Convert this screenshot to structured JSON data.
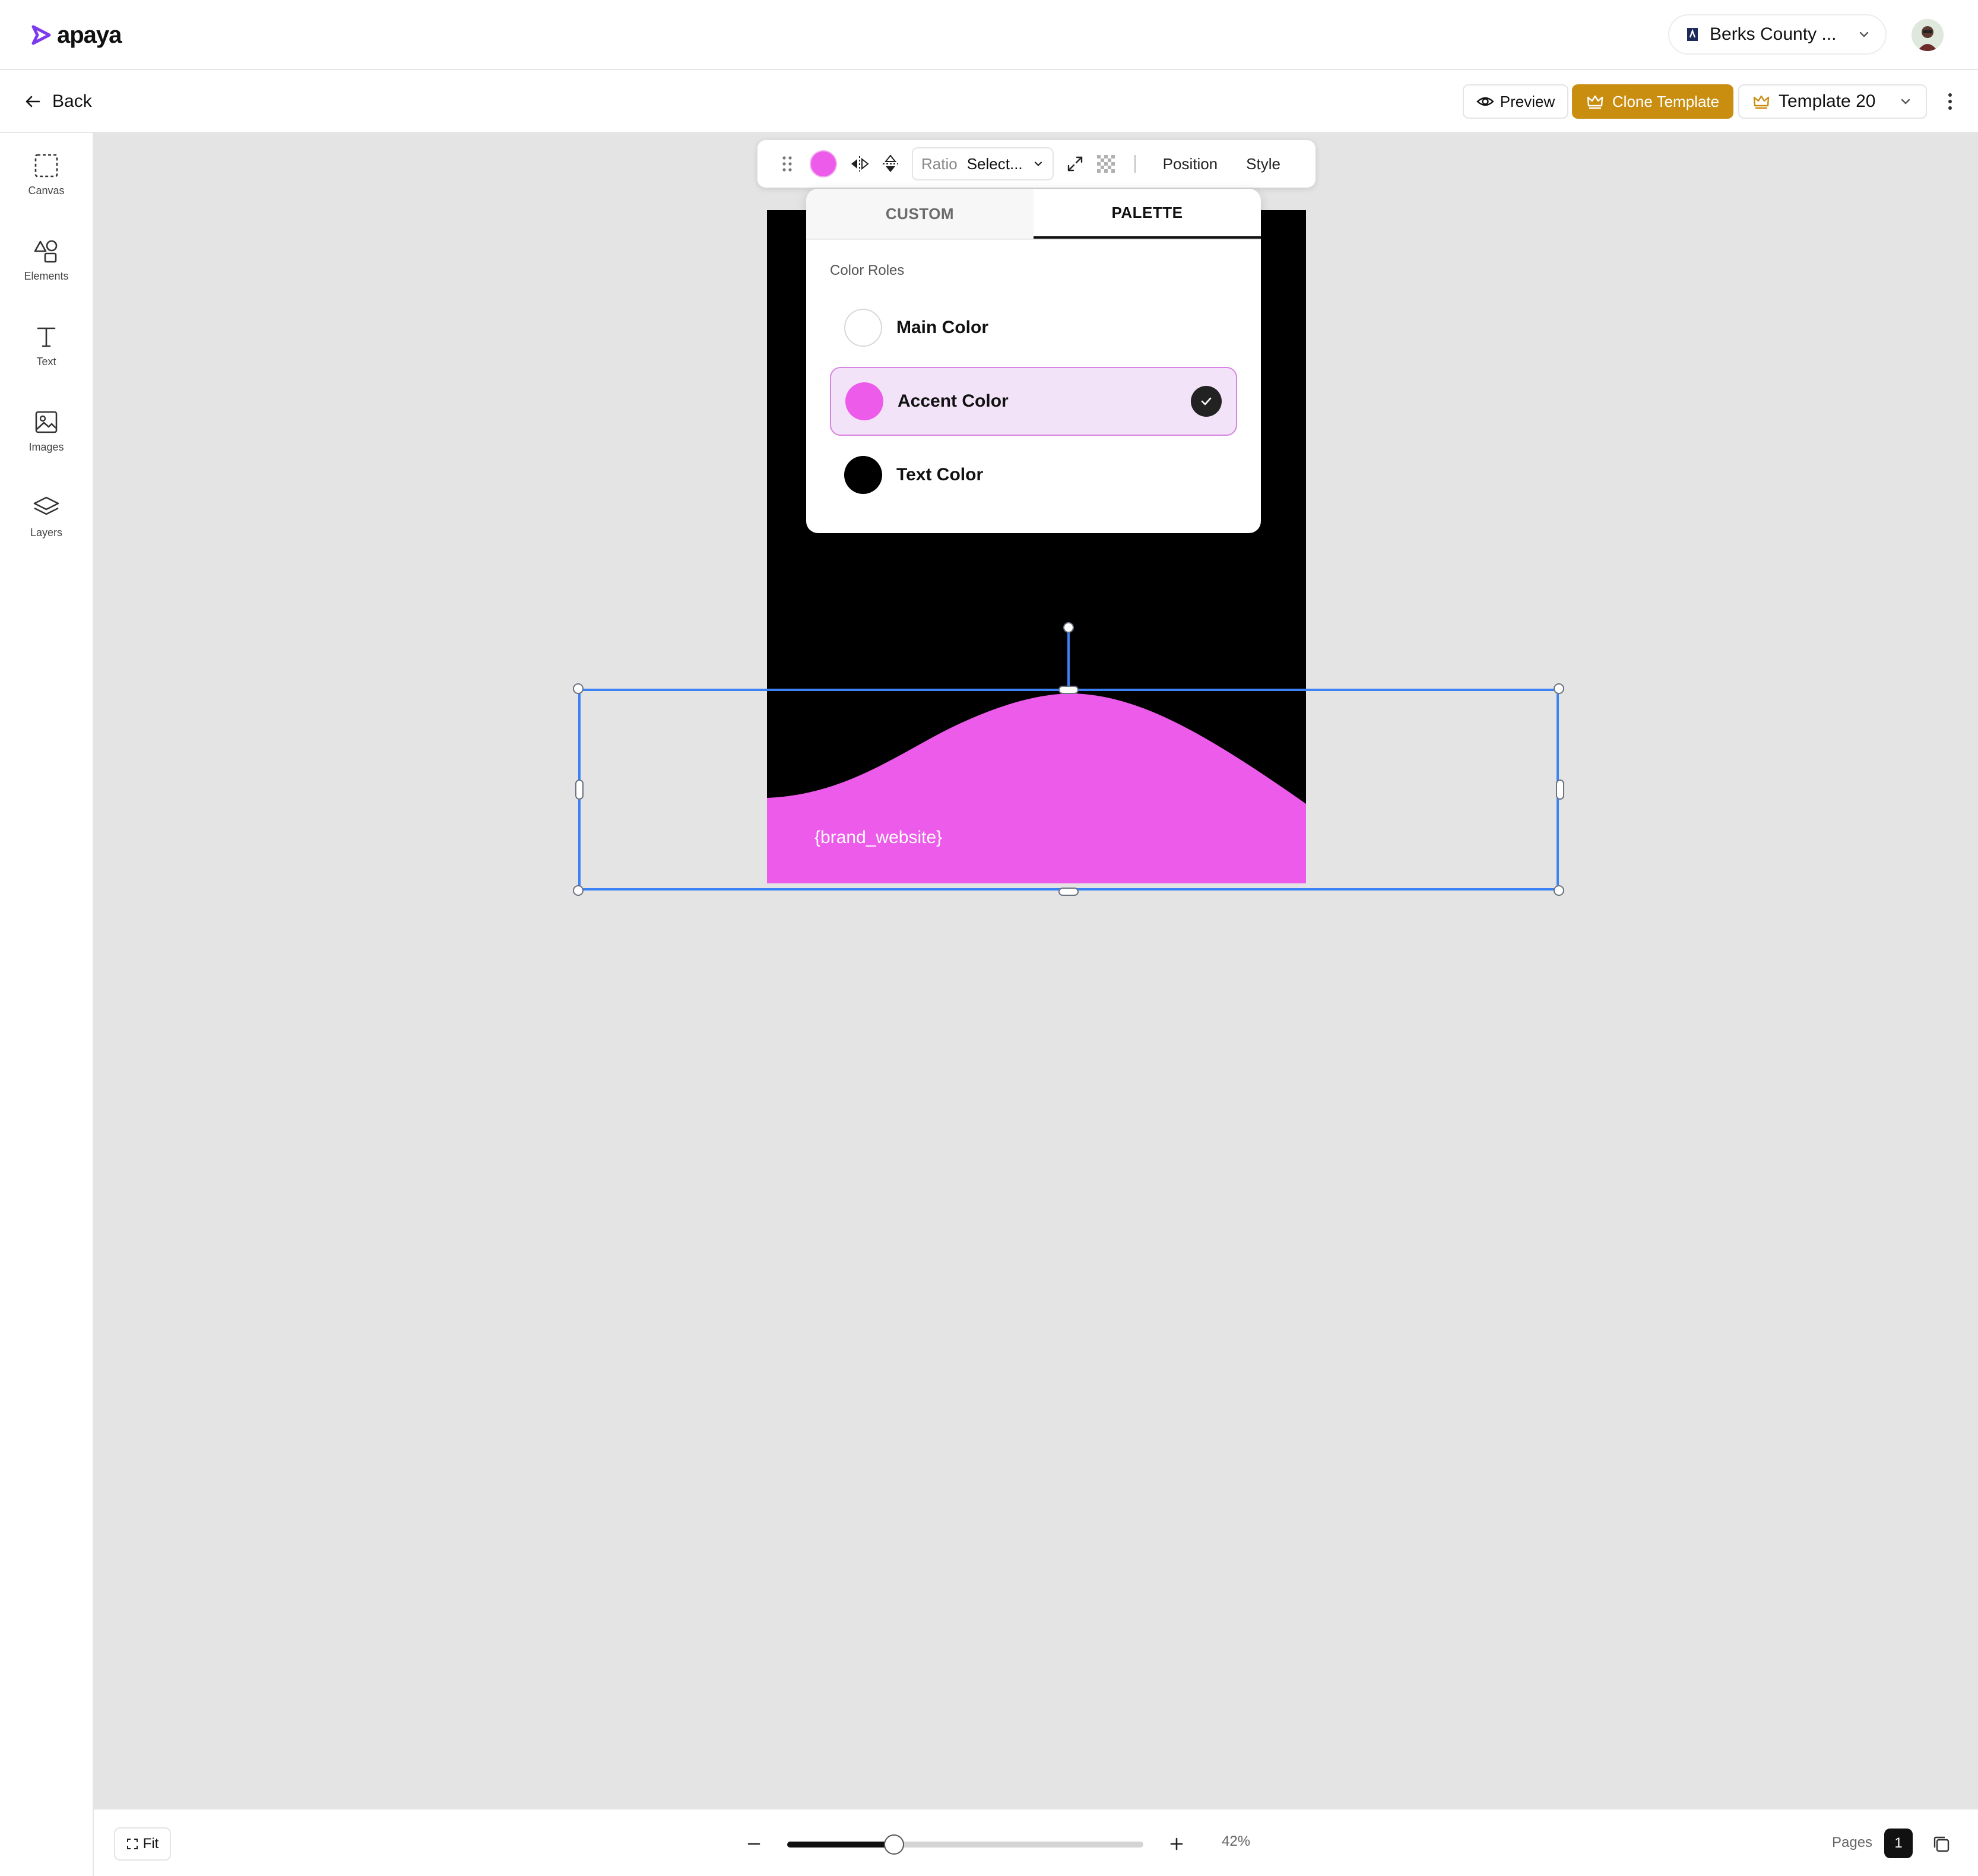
{
  "header": {
    "logo_text": "apaya",
    "account_name": "Berks County ...",
    "colors": {
      "brand": "#7c3aed",
      "border": "#e6e6e6"
    }
  },
  "subbar": {
    "back_label": "Back",
    "preview_label": "Preview",
    "clone_label": "Clone Template",
    "template_label": "Template 20",
    "colors": {
      "clone_bg": "#c98d10"
    }
  },
  "sidebar": {
    "items": [
      {
        "label": "Canvas",
        "icon": "canvas-icon"
      },
      {
        "label": "Elements",
        "icon": "elements-icon"
      },
      {
        "label": "Text",
        "icon": "text-icon"
      },
      {
        "label": "Images",
        "icon": "images-icon"
      },
      {
        "label": "Layers",
        "icon": "layers-icon"
      }
    ]
  },
  "toolbar": {
    "ratio_label": "Ratio",
    "ratio_value": "Select...",
    "position_label": "Position",
    "style_label": "Style",
    "current_color": "#ec5be9"
  },
  "color_popover": {
    "tabs": [
      {
        "label": "CUSTOM",
        "active": false
      },
      {
        "label": "PALETTE",
        "active": true
      }
    ],
    "section_title": "Color Roles",
    "roles": [
      {
        "label": "Main Color",
        "color": "#ffffff",
        "selected": false
      },
      {
        "label": "Accent Color",
        "color": "#ec5be9",
        "selected": true
      },
      {
        "label": "Text Color",
        "color": "#000000",
        "selected": false
      }
    ]
  },
  "canvas": {
    "brand_website": "{brand_website}",
    "colors": {
      "background": "#000000",
      "accent": "#ec5be9",
      "selection": "#3b82f6"
    }
  },
  "bottombar": {
    "fit_label": "Fit",
    "zoom_level": "42%",
    "zoom_fraction": 0.3,
    "pages_label": "Pages",
    "page_count": "1"
  }
}
